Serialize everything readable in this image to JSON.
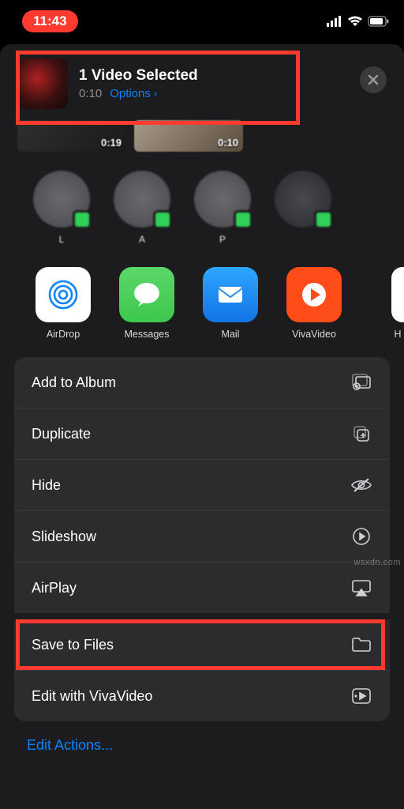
{
  "status": {
    "time": "11:43"
  },
  "header": {
    "title": "1 Video Selected",
    "duration": "0:10",
    "options_label": "Options"
  },
  "thumbs": [
    {
      "duration": "0:19"
    },
    {
      "duration": "0:10"
    }
  ],
  "contacts": [
    {
      "name": "L"
    },
    {
      "name": "A"
    },
    {
      "name": "P"
    },
    {
      "name": " "
    }
  ],
  "apps": {
    "airdrop": "AirDrop",
    "messages": "Messages",
    "mail": "Mail",
    "vivavideo": "VivaVideo",
    "partial": "H"
  },
  "actions": {
    "add_album": "Add to Album",
    "duplicate": "Duplicate",
    "hide": "Hide",
    "slideshow": "Slideshow",
    "airplay": "AirPlay",
    "save_files": "Save to Files",
    "edit_viva": "Edit with VivaVideo"
  },
  "edit_actions": "Edit Actions...",
  "watermark": "wsxdn.com"
}
